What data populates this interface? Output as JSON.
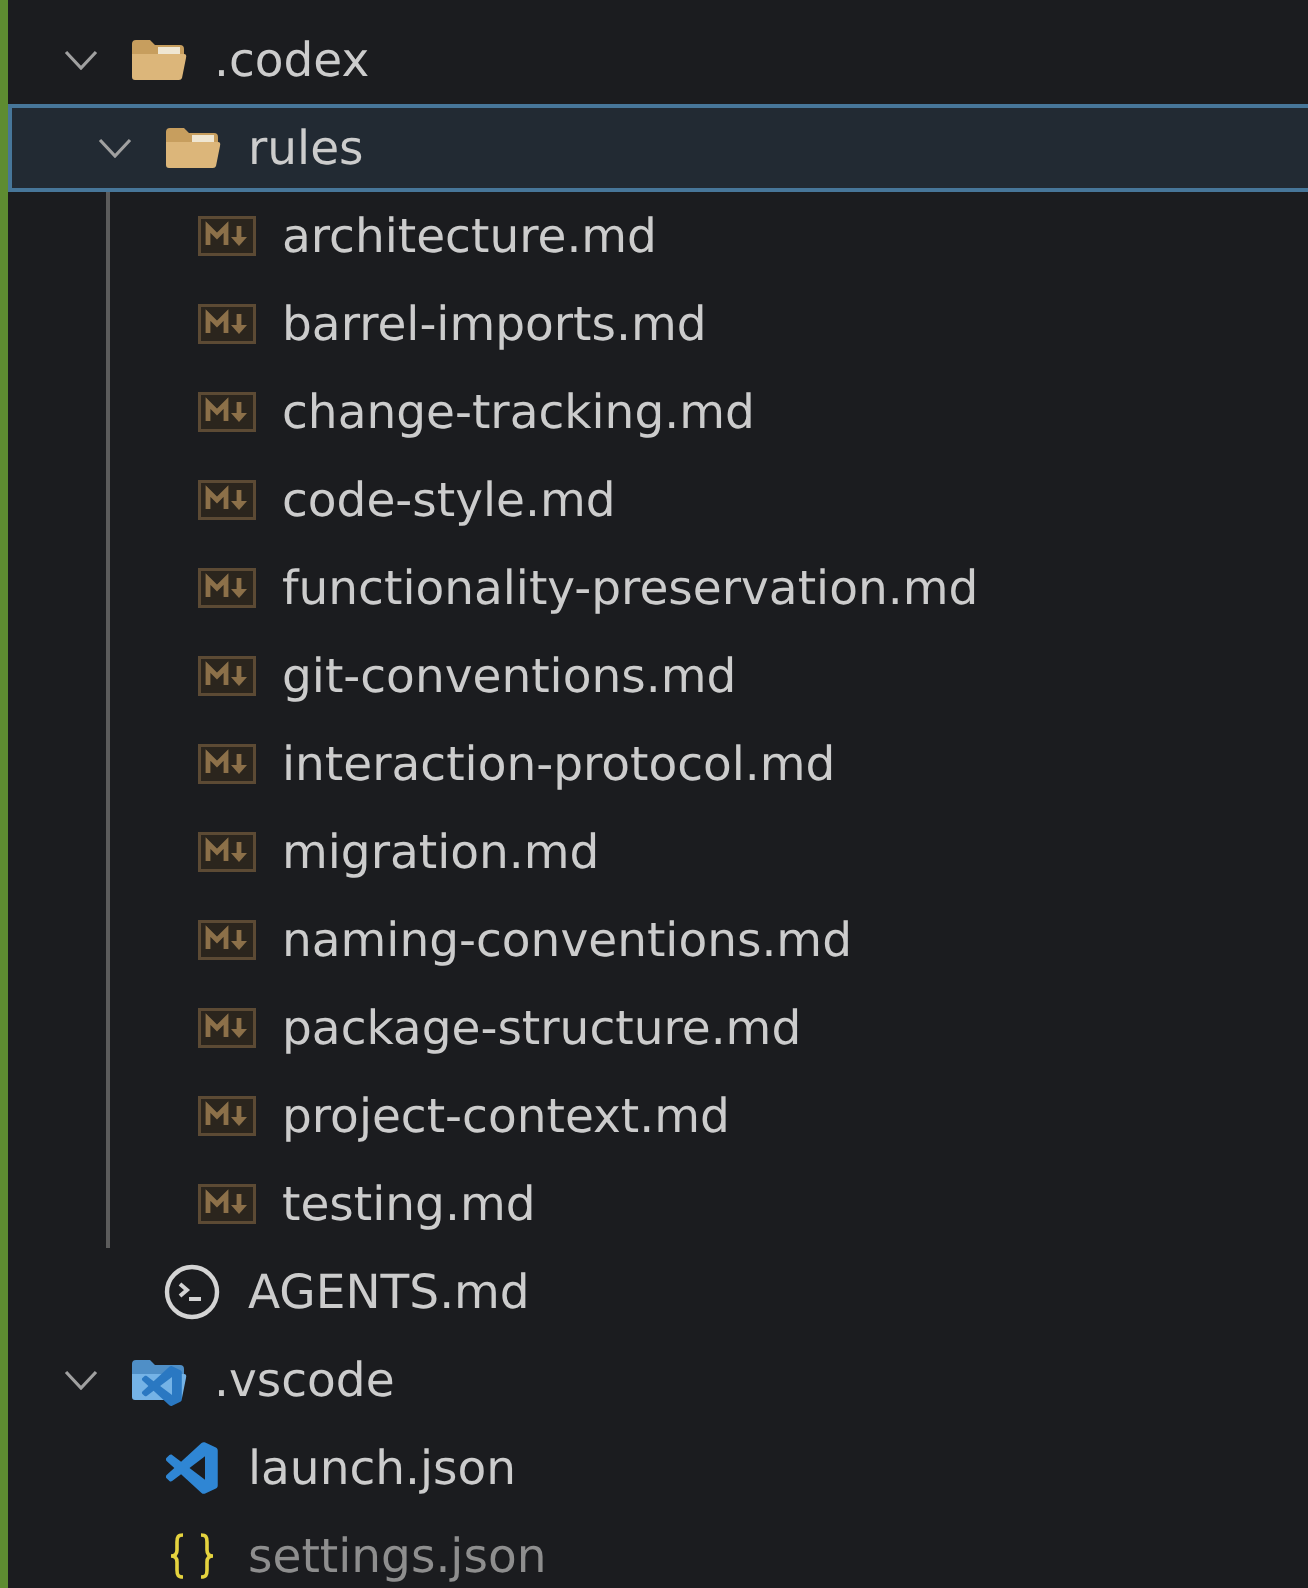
{
  "tree": [
    {
      "kind": "folder",
      "name": ".codex",
      "expanded": true,
      "selected": false,
      "dimmed": false,
      "children": [
        {
          "kind": "folder",
          "name": "rules",
          "expanded": true,
          "selected": true,
          "dimmed": false,
          "children": [
            {
              "kind": "markdown",
              "name": "architecture.md",
              "selected": false,
              "dimmed": false
            },
            {
              "kind": "markdown",
              "name": "barrel-imports.md",
              "selected": false,
              "dimmed": false
            },
            {
              "kind": "markdown",
              "name": "change-tracking.md",
              "selected": false,
              "dimmed": false
            },
            {
              "kind": "markdown",
              "name": "code-style.md",
              "selected": false,
              "dimmed": false
            },
            {
              "kind": "markdown",
              "name": "functionality-preservation.md",
              "selected": false,
              "dimmed": false
            },
            {
              "kind": "markdown",
              "name": "git-conventions.md",
              "selected": false,
              "dimmed": false
            },
            {
              "kind": "markdown",
              "name": "interaction-protocol.md",
              "selected": false,
              "dimmed": false
            },
            {
              "kind": "markdown",
              "name": "migration.md",
              "selected": false,
              "dimmed": false
            },
            {
              "kind": "markdown",
              "name": "naming-conventions.md",
              "selected": false,
              "dimmed": false
            },
            {
              "kind": "markdown",
              "name": "package-structure.md",
              "selected": false,
              "dimmed": false
            },
            {
              "kind": "markdown",
              "name": "project-context.md",
              "selected": false,
              "dimmed": false
            },
            {
              "kind": "markdown",
              "name": "testing.md",
              "selected": false,
              "dimmed": false
            }
          ]
        },
        {
          "kind": "agents",
          "name": "AGENTS.md",
          "selected": false,
          "dimmed": false
        }
      ]
    },
    {
      "kind": "vscodefolder",
      "name": ".vscode",
      "expanded": true,
      "selected": false,
      "dimmed": false,
      "children": [
        {
          "kind": "vscode",
          "name": "launch.json",
          "selected": false,
          "dimmed": false
        },
        {
          "kind": "json",
          "name": "settings.json",
          "selected": false,
          "dimmed": true
        }
      ]
    }
  ]
}
